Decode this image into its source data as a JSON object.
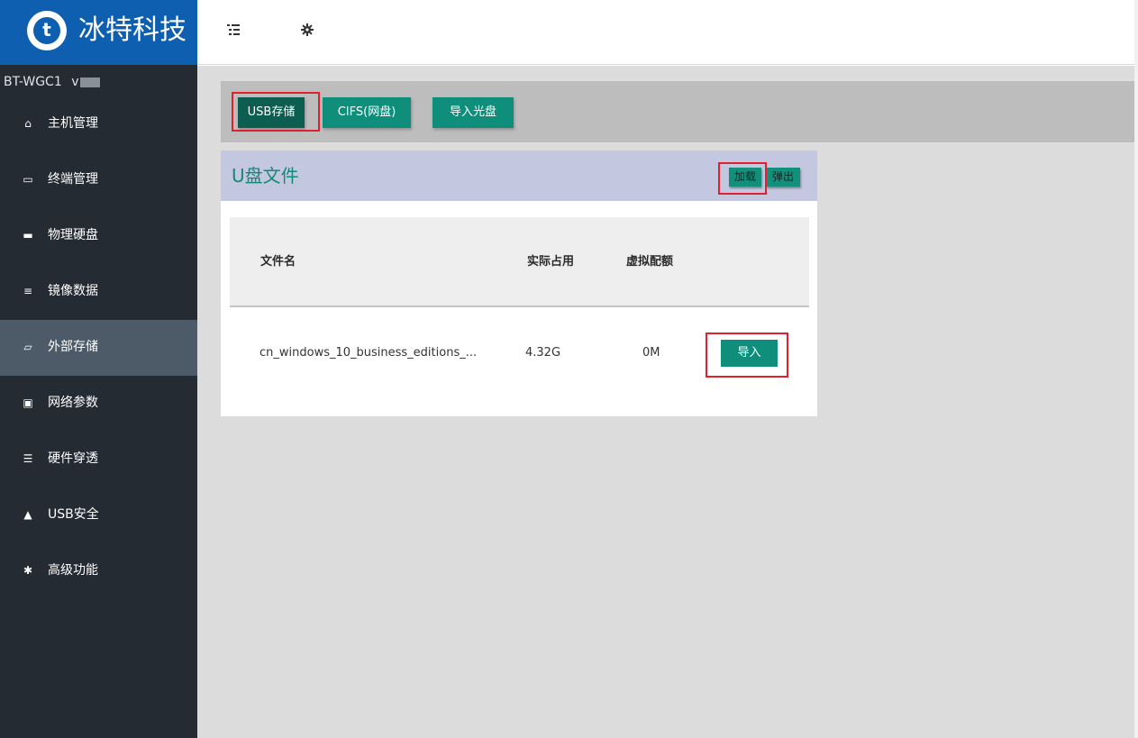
{
  "brand": {
    "logo_letter": "t",
    "name": "冰特科技"
  },
  "device": {
    "name": "BT-WGC1",
    "version_prefix": "v"
  },
  "sidebar": {
    "items": [
      {
        "label": "主机管理",
        "icon": "home-icon",
        "glyph": "⌂"
      },
      {
        "label": "终端管理",
        "icon": "monitor-icon",
        "glyph": "▭"
      },
      {
        "label": "物理硬盘",
        "icon": "hard-disk-icon",
        "glyph": "▬"
      },
      {
        "label": "镜像数据",
        "icon": "database-icon",
        "glyph": "≡"
      },
      {
        "label": "外部存储",
        "icon": "folder-icon",
        "glyph": "▱"
      },
      {
        "label": "网络参数",
        "icon": "network-port-icon",
        "glyph": "▣"
      },
      {
        "label": "硬件穿透",
        "icon": "list-tree-icon",
        "glyph": "☰"
      },
      {
        "label": "USB安全",
        "icon": "lock-icon",
        "glyph": "▲"
      },
      {
        "label": "高级功能",
        "icon": "gear-icon",
        "glyph": "✱"
      }
    ],
    "active_item": "外部存储"
  },
  "header": {
    "menu_icon": "list-tree-icon",
    "settings_icon": "gear-icon"
  },
  "toolbar": {
    "usb_label": "USB存储",
    "cifs_label": "CIFS(网盘)",
    "import_cd_label": "导入光盘"
  },
  "panel": {
    "title": "U盘文件",
    "load_label": "加载",
    "eject_label": "弹出"
  },
  "table": {
    "columns": [
      "文件名",
      "实际占用",
      "虚拟配额"
    ],
    "rows": [
      {
        "name": "cn_windows_10_business_editions_...",
        "used": "4.32G",
        "quota": "0M",
        "action": "导入"
      }
    ]
  },
  "colors": {
    "brand_blue": "#0f5fb0",
    "sidebar_bg": "#242b33",
    "sidebar_active": "#4d5a68",
    "accent_teal": "#0e8e7b",
    "highlight_red": "#e0202e"
  }
}
